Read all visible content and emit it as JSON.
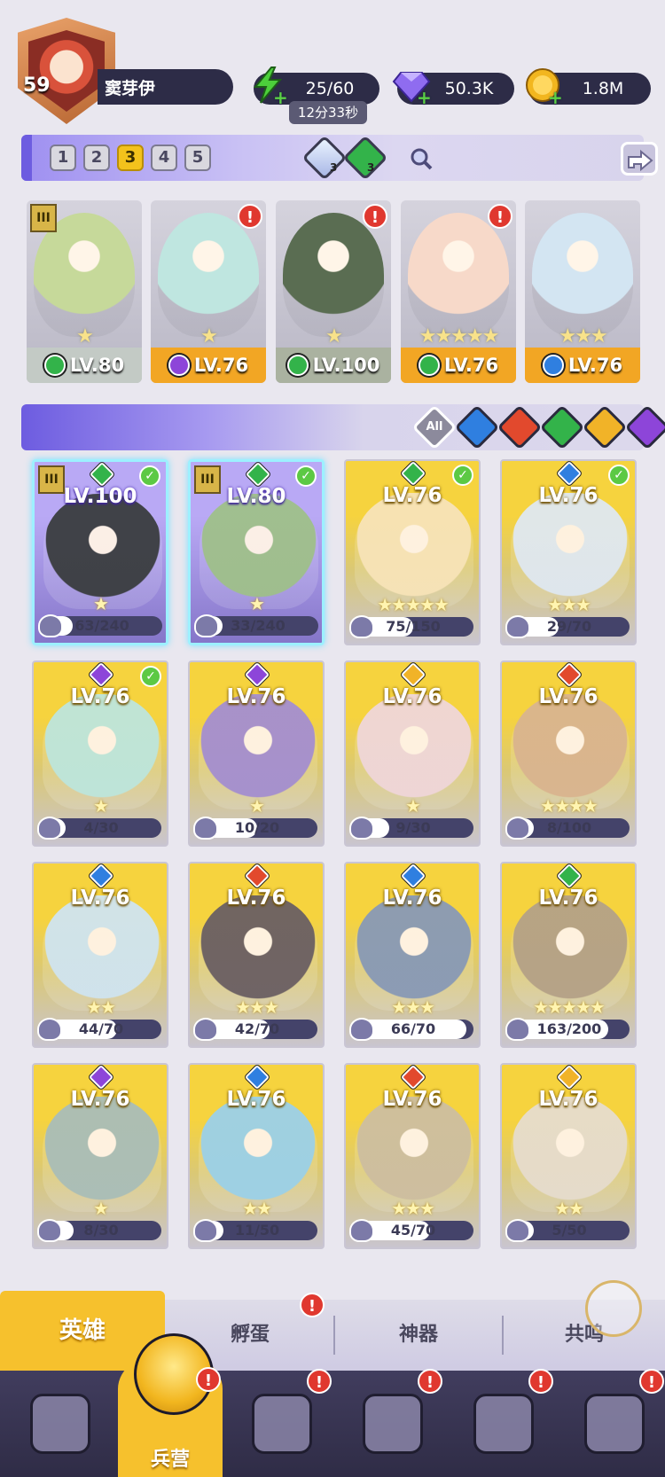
{
  "player": {
    "level": "59",
    "name": "窦芽伊"
  },
  "resources": {
    "energy": {
      "value": "25/60",
      "icon": "lightning-icon",
      "color": "#4ccf3b"
    },
    "energy_timer": "12分33秒",
    "gems": {
      "value": "50.3K",
      "icon": "gem-icon",
      "color": "#8f6cf0"
    },
    "gold": {
      "value": "1.8M",
      "icon": "coin-icon",
      "color": "#f2b61f"
    }
  },
  "team_bar": {
    "tabs": [
      "1",
      "2",
      "3",
      "4",
      "5"
    ],
    "active_tab": "3",
    "token_a": {
      "count": "3",
      "icon": "water-token-icon"
    },
    "token_b": {
      "count": "3",
      "icon": "leaf-token-icon"
    },
    "search_icon": "search-icon",
    "share_icon": "share-icon"
  },
  "team_heroes": [
    {
      "level": "LV.80",
      "element": "nature",
      "stars": "★",
      "rank": "III",
      "alert": false,
      "bg": "#c6d99a"
    },
    {
      "level": "LV.76",
      "element": "dark",
      "stars": "★",
      "rank": "",
      "alert": true,
      "bg": "#bfe6e0"
    },
    {
      "level": "LV.100",
      "element": "nature",
      "stars": "★",
      "rank": "",
      "alert": true,
      "bg": "#5a6d52"
    },
    {
      "level": "LV.76",
      "element": "nature",
      "stars": "★★★★★",
      "rank": "",
      "alert": true,
      "bg": "#f7d9c9"
    },
    {
      "level": "LV.76",
      "element": "water",
      "stars": "★★★",
      "rank": "",
      "alert": false,
      "bg": "#d3e5f2"
    }
  ],
  "filter": {
    "all_label": "All",
    "elements": [
      {
        "name": "water",
        "color": "#2f7fe0"
      },
      {
        "name": "fire",
        "color": "#e2492d"
      },
      {
        "name": "nature",
        "color": "#33b34a"
      },
      {
        "name": "light",
        "color": "#f1b328"
      },
      {
        "name": "dark",
        "color": "#8d45d9"
      }
    ]
  },
  "alert_mark": "!",
  "check_mark": "✓",
  "heroes": [
    {
      "level": "LV.100",
      "element": "nature",
      "fragments": "63/240",
      "progress": 0.26,
      "stars": "★",
      "selected": true,
      "checked": true,
      "rank": "III",
      "bg": "#3a3d3f"
    },
    {
      "level": "LV.80",
      "element": "nature",
      "fragments": "33/240",
      "progress": 0.14,
      "stars": "★",
      "selected": true,
      "checked": true,
      "rank": "III",
      "bg": "#9fc08a"
    },
    {
      "level": "LV.76",
      "element": "nature",
      "fragments": "75/150",
      "progress": 0.5,
      "stars": "★★★★★",
      "selected": false,
      "checked": true,
      "rank": "",
      "bg": "#f7e3b8"
    },
    {
      "level": "LV.76",
      "element": "water",
      "fragments": "29/70",
      "progress": 0.41,
      "stars": "★★★",
      "selected": false,
      "checked": true,
      "rank": "",
      "bg": "#dfe8f1"
    },
    {
      "level": "LV.76",
      "element": "dark",
      "fragments": "4/30",
      "progress": 0.13,
      "stars": "★",
      "selected": false,
      "checked": true,
      "rank": "",
      "bg": "#bde5dc"
    },
    {
      "level": "LV.76",
      "element": "dark",
      "fragments": "10/20",
      "progress": 0.5,
      "stars": "★",
      "selected": false,
      "checked": false,
      "rank": "",
      "bg": "#a48ed0"
    },
    {
      "level": "LV.76",
      "element": "light",
      "fragments": "9/30",
      "progress": 0.3,
      "stars": "★",
      "selected": false,
      "checked": false,
      "rank": "",
      "bg": "#efd6d9"
    },
    {
      "level": "LV.76",
      "element": "fire",
      "fragments": "8/100",
      "progress": 0.08,
      "stars": "★★★★",
      "selected": false,
      "checked": false,
      "rank": "",
      "bg": "#d9b48f"
    },
    {
      "level": "LV.76",
      "element": "water",
      "fragments": "44/70",
      "progress": 0.63,
      "stars": "★★",
      "selected": false,
      "checked": false,
      "rank": "",
      "bg": "#cfe4f0"
    },
    {
      "level": "LV.76",
      "element": "fire",
      "fragments": "42/70",
      "progress": 0.6,
      "stars": "★★★",
      "selected": false,
      "checked": false,
      "rank": "",
      "bg": "#6a5f63"
    },
    {
      "level": "LV.76",
      "element": "water",
      "fragments": "66/70",
      "progress": 0.94,
      "stars": "★★★",
      "selected": false,
      "checked": false,
      "rank": "",
      "bg": "#8899b6"
    },
    {
      "level": "LV.76",
      "element": "nature",
      "fragments": "163/200",
      "progress": 0.82,
      "stars": "★★★★★",
      "selected": false,
      "checked": false,
      "rank": "",
      "bg": "#b4a187"
    },
    {
      "level": "LV.76",
      "element": "dark",
      "fragments": "8/30",
      "progress": 0.27,
      "stars": "★",
      "selected": false,
      "checked": false,
      "rank": "",
      "bg": "#a9bdb8"
    },
    {
      "level": "LV.76",
      "element": "water",
      "fragments": "11/50",
      "progress": 0.22,
      "stars": "★★",
      "selected": false,
      "checked": false,
      "rank": "",
      "bg": "#9bd0e8"
    },
    {
      "level": "LV.76",
      "element": "fire",
      "fragments": "45/70",
      "progress": 0.64,
      "stars": "★★★",
      "selected": false,
      "checked": false,
      "rank": "",
      "bg": "#cdbea0"
    },
    {
      "level": "LV.76",
      "element": "light",
      "fragments": "5/50",
      "progress": 0.1,
      "stars": "★★",
      "selected": false,
      "checked": false,
      "rank": "",
      "bg": "#e6dccd"
    }
  ],
  "sub_tabs": [
    {
      "label": "英雄",
      "active": true,
      "alert": false
    },
    {
      "label": "孵蛋",
      "active": false,
      "alert": true
    },
    {
      "label": "神器",
      "active": false,
      "alert": false
    },
    {
      "label": "共鸣",
      "active": false,
      "alert": false
    }
  ],
  "nav": [
    {
      "label": "",
      "icon": "cards-icon",
      "active": false,
      "alert": false
    },
    {
      "label": "兵营",
      "icon": "barracks-icon",
      "active": true,
      "alert": true
    },
    {
      "label": "",
      "icon": "map-icon",
      "active": false,
      "alert": true
    },
    {
      "label": "",
      "icon": "castle-icon",
      "active": false,
      "alert": true
    },
    {
      "label": "",
      "icon": "mushroom-guild-icon",
      "active": false,
      "alert": true
    },
    {
      "label": "",
      "icon": "banner-icon",
      "active": false,
      "alert": true
    }
  ],
  "colors": {
    "accent": "#f6c12d",
    "panel_purple": "#6d5ce0",
    "dark_pill": "#2d2c47"
  }
}
